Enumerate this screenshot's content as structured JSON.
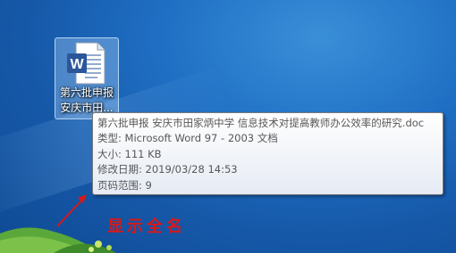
{
  "desktop": {
    "file_icon": {
      "icon": "word-document-icon",
      "label_line1": "第六批申报",
      "label_line2": "安庆市田..."
    }
  },
  "tooltip": {
    "filename": "第六批申报 安庆市田家炳中学 信息技术对提高教师办公效率的研究.doc",
    "type": "类型: Microsoft Word 97 - 2003 文档",
    "size": "大小: 111 KB",
    "modified": "修改日期: 2019/03/28 14:53",
    "pages": "页码范围: 9"
  },
  "annotation": {
    "text": "显示全名",
    "color": "#d81818"
  },
  "colors": {
    "desktop_bg": "#1f6fc4",
    "word_blue": "#2b579a"
  }
}
